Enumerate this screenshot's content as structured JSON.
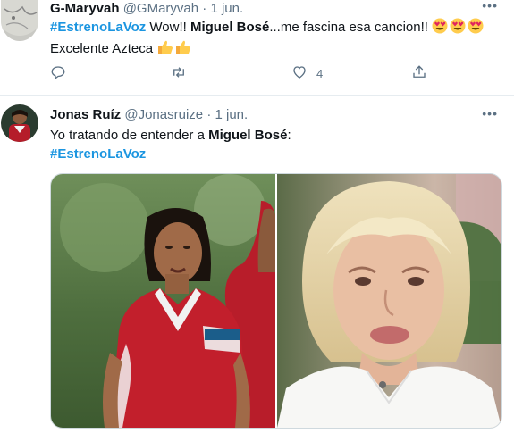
{
  "tweets": [
    {
      "author_name": "G-Maryvah",
      "handle": "@GMaryvah",
      "separator": "·",
      "date": "1 jun.",
      "more": "•••",
      "hashtag": "#EstrenoLaVoz",
      "text_part1": " Wow!! ",
      "mention": "Miguel Bosé",
      "text_part2": "...me fascina esa cancion!! ",
      "emoji": "heart-eyes-emoji",
      "line2": "Excelente Azteca ",
      "emoji2": "thumbs-up-emoji",
      "actions": {
        "likes": "4"
      }
    },
    {
      "author_name": "Jonas Ruíz",
      "handle": "@Jonasruize",
      "separator": "·",
      "date": "1 jun.",
      "more": "•••",
      "line1_part1": "Yo tratando de entender a  ",
      "mention": "Miguel Bosé",
      "line1_part2": ":",
      "hashtag": "#EstrenoLaVoz",
      "media": [
        "athlete-photo",
        "woman-portrait-photo"
      ]
    }
  ],
  "colors": {
    "hashtag": "#1b95e0",
    "secondary": "#5b7083",
    "border": "#e6ecf0"
  }
}
